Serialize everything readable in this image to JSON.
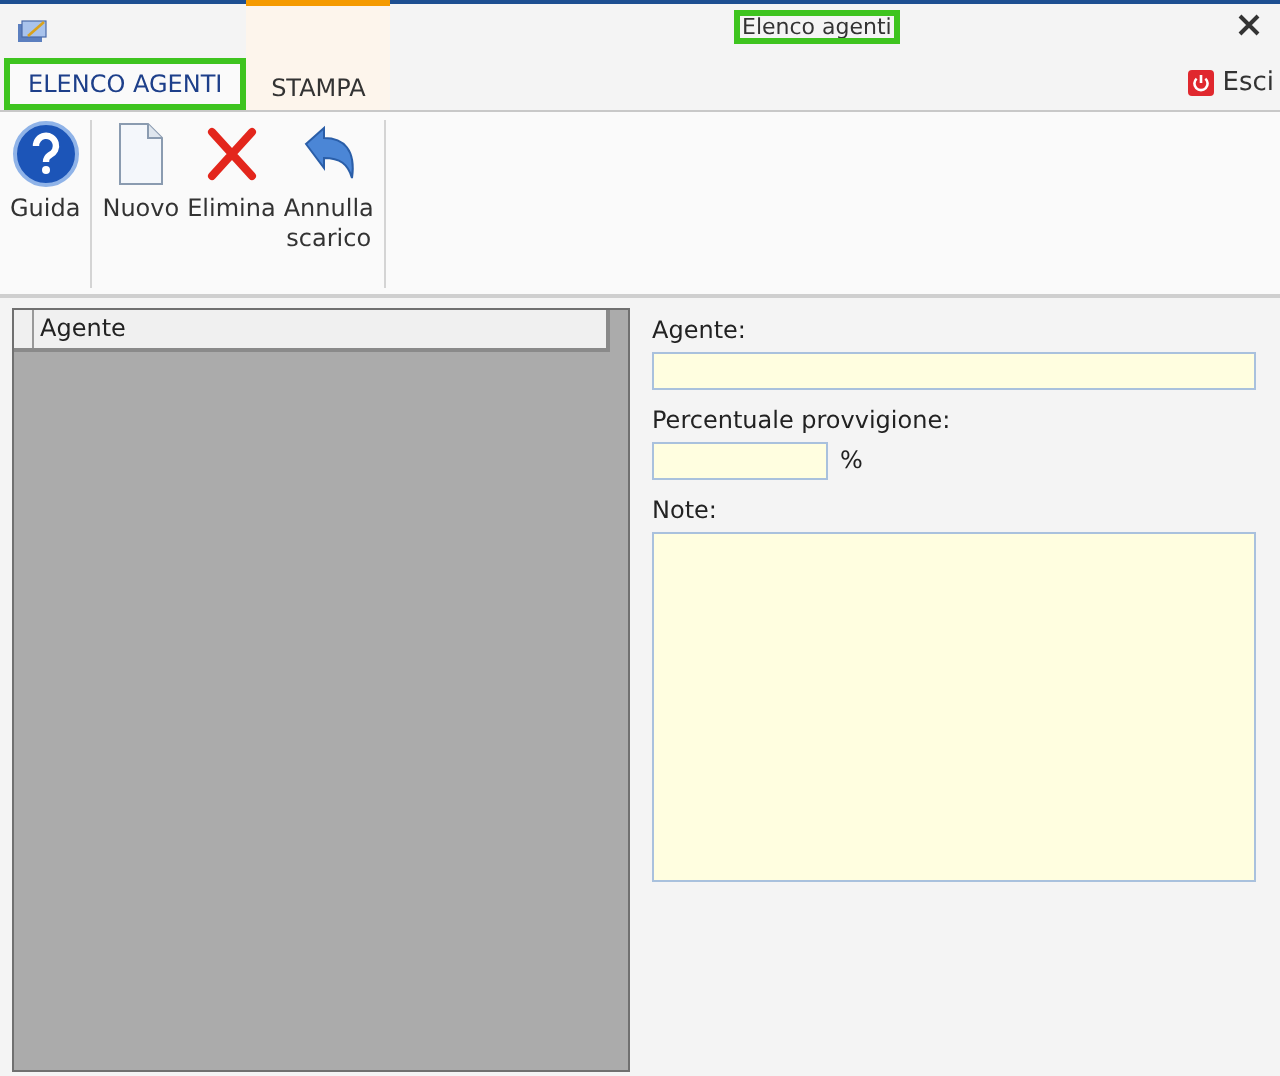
{
  "window": {
    "title": "Elenco agenti",
    "title_highlighted": true
  },
  "tabs": [
    {
      "label": "ELENCO AGENTI",
      "selected": true,
      "highlighted": true
    },
    {
      "label": "STAMPA",
      "selected": false,
      "highlighted": false
    }
  ],
  "exit_button": {
    "label": "Esci"
  },
  "toolbar": {
    "groups": [
      [
        {
          "label": "Guida",
          "kind": "help"
        }
      ],
      [
        {
          "label": "Nuovo",
          "kind": "new"
        },
        {
          "label": "Elimina",
          "kind": "delete"
        },
        {
          "label": "Annulla\nscarico",
          "kind": "undo"
        }
      ]
    ]
  },
  "table": {
    "columns": [
      "Agente"
    ]
  },
  "form": {
    "agent_label": "Agente:",
    "percent_label": "Percentuale provvigione:",
    "percent_unit": "%",
    "notes_label": "Note:"
  }
}
